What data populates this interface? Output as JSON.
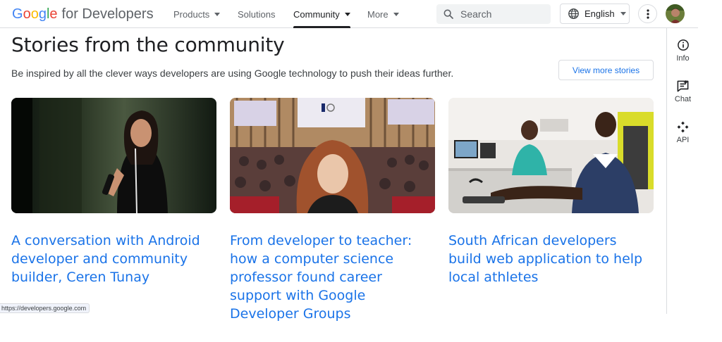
{
  "header": {
    "logo_letters": [
      "G",
      "o",
      "o",
      "g",
      "l",
      "e"
    ],
    "logo_suffix": "for Developers",
    "nav": [
      {
        "label": "Products"
      },
      {
        "label": "Solutions"
      },
      {
        "label": "Community"
      },
      {
        "label": "More"
      }
    ],
    "active_nav": "Community",
    "search_placeholder": "Search",
    "language": "English"
  },
  "right_rail": [
    {
      "label": "Info",
      "icon": "info-icon"
    },
    {
      "label": "Chat",
      "icon": "chat-icon"
    },
    {
      "label": "API",
      "icon": "api-icon"
    }
  ],
  "main": {
    "title": "Stories from the community",
    "subtitle": "Be inspired by all the clever ways developers are using Google technology to push their ideas further.",
    "view_more_label": "View more stories",
    "cards": [
      {
        "title": "A conversation with Android developer and community builder, Ceren Tunay"
      },
      {
        "title": "From developer to teacher: how a computer science professor found career support with Google Developer Groups"
      },
      {
        "title": "South African developers build web application to help local athletes"
      }
    ]
  },
  "status_url": "https://developers.google.com",
  "colors": {
    "link": "#1a73e8",
    "text": "#202124",
    "border": "#dadce0",
    "search_bg": "#f1f3f4"
  }
}
